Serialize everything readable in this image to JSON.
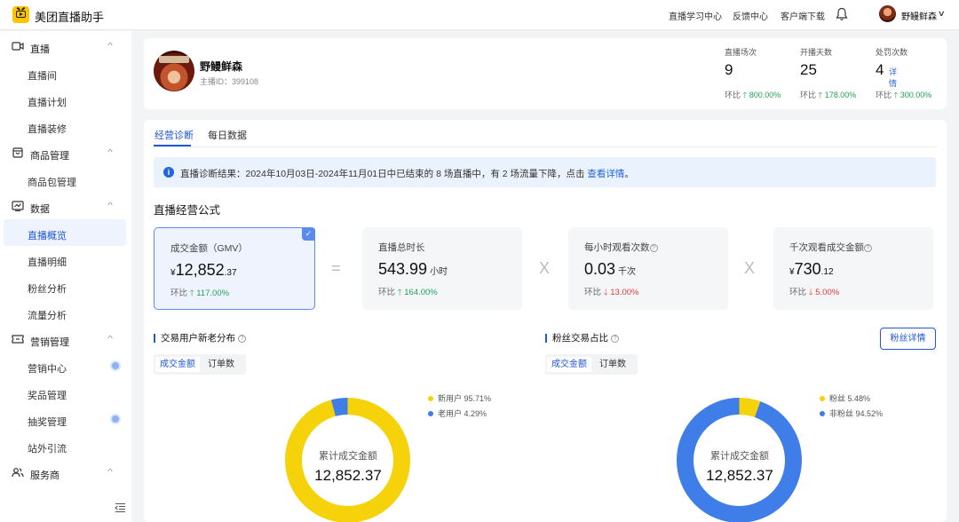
{
  "app": {
    "title": "美团直播助手"
  },
  "topbar": {
    "links": [
      "直播学习中心",
      "反馈中心",
      "客户端下载"
    ],
    "username": "野鳗鲜森"
  },
  "sidebar": {
    "groups": [
      {
        "label": "直播",
        "icon": "video-camera-icon",
        "items": [
          "直播间",
          "直播计划",
          "直播装修"
        ]
      },
      {
        "label": "商品管理",
        "icon": "shopping-bag-icon",
        "items": [
          "商品包管理"
        ]
      },
      {
        "label": "数据",
        "icon": "chart-icon",
        "items": [
          "直播概览",
          "直播明细",
          "粉丝分析",
          "流量分析"
        ]
      },
      {
        "label": "营销管理",
        "icon": "coupon-icon",
        "items": [
          "营销中心",
          "奖品管理",
          "抽奖管理",
          "站外引流"
        ]
      },
      {
        "label": "服务商",
        "icon": "users-icon",
        "items": []
      }
    ],
    "active_item": "直播概览"
  },
  "profile": {
    "name": "野鳗鲜森",
    "id_label": "主播ID：399108",
    "stats": [
      {
        "label": "直播场次",
        "value": "9",
        "cmp_label": "环比",
        "cmp_value": "800.00%",
        "trend": "up"
      },
      {
        "label": "开播天数",
        "value": "25",
        "cmp_label": "环比",
        "cmp_value": "178.00%",
        "trend": "up"
      },
      {
        "label": "处罚次数",
        "value": "4",
        "link": "详情",
        "cmp_label": "环比",
        "cmp_value": "300.00%",
        "trend": "up"
      }
    ]
  },
  "tabs": [
    {
      "label": "经营诊断",
      "active": true
    },
    {
      "label": "每日数据",
      "active": false
    }
  ],
  "alert": {
    "text": "直播诊断结果：2024年10月03日-2024年11月01日中已结束的 8 场直播中，有 2 场流量下降，点击 ",
    "link": "查看详情",
    "suffix": "。"
  },
  "formula": {
    "title": "直播经营公式",
    "metrics": [
      {
        "label": "成交金额（GMV）",
        "prefix": "¥",
        "value": "12,852",
        "decimal": ".37",
        "unit": "",
        "cmp_label": "环比",
        "cmp_value": "117.00%",
        "trend": "up",
        "selected": true,
        "help": false
      },
      {
        "label": "直播总时长",
        "prefix": "",
        "value": "543.99",
        "decimal": "",
        "unit": "小时",
        "cmp_label": "环比",
        "cmp_value": "164.00%",
        "trend": "up",
        "selected": false,
        "help": false
      },
      {
        "label": "每小时观看次数",
        "prefix": "",
        "value": "0.03",
        "decimal": "",
        "unit": "千次",
        "cmp_label": "环比",
        "cmp_value": "13.00%",
        "trend": "down",
        "selected": false,
        "help": true
      },
      {
        "label": "千次观看成交金额",
        "prefix": "¥",
        "value": "730",
        "decimal": ".12",
        "unit": "",
        "cmp_label": "环比",
        "cmp_value": "5.00%",
        "trend": "down",
        "selected": false,
        "help": true
      }
    ],
    "operators": [
      "=",
      "X",
      "X"
    ]
  },
  "user_distribution": {
    "title": "交易用户新老分布",
    "seg_options": [
      "成交金额",
      "订单数"
    ],
    "center_label": "累计成交金额",
    "center_value": "12,852.37",
    "legend": [
      {
        "name": "新用户",
        "value": "95.71%",
        "color": "#f5d20a"
      },
      {
        "name": "老用户",
        "value": "4.29%",
        "color": "#3f7de8"
      }
    ]
  },
  "fans_ratio": {
    "title": "粉丝交易占比",
    "button": "粉丝详情",
    "seg_options": [
      "成交金额",
      "订单数"
    ],
    "center_label": "累计成交金额",
    "center_value": "12,852.37",
    "legend": [
      {
        "name": "粉丝",
        "value": "5.48%",
        "color": "#f5d20a"
      },
      {
        "name": "非粉丝",
        "value": "94.52%",
        "color": "#3f7de8"
      }
    ]
  },
  "chart_data": [
    {
      "type": "pie",
      "title": "交易用户新老分布",
      "categories": [
        "新用户",
        "老用户"
      ],
      "values": [
        95.71,
        4.29
      ],
      "colors": [
        "#f5d20a",
        "#3f7de8"
      ]
    },
    {
      "type": "pie",
      "title": "粉丝交易占比",
      "categories": [
        "粉丝",
        "非粉丝"
      ],
      "values": [
        5.48,
        94.52
      ],
      "colors": [
        "#f5d20a",
        "#3f7de8"
      ]
    }
  ]
}
